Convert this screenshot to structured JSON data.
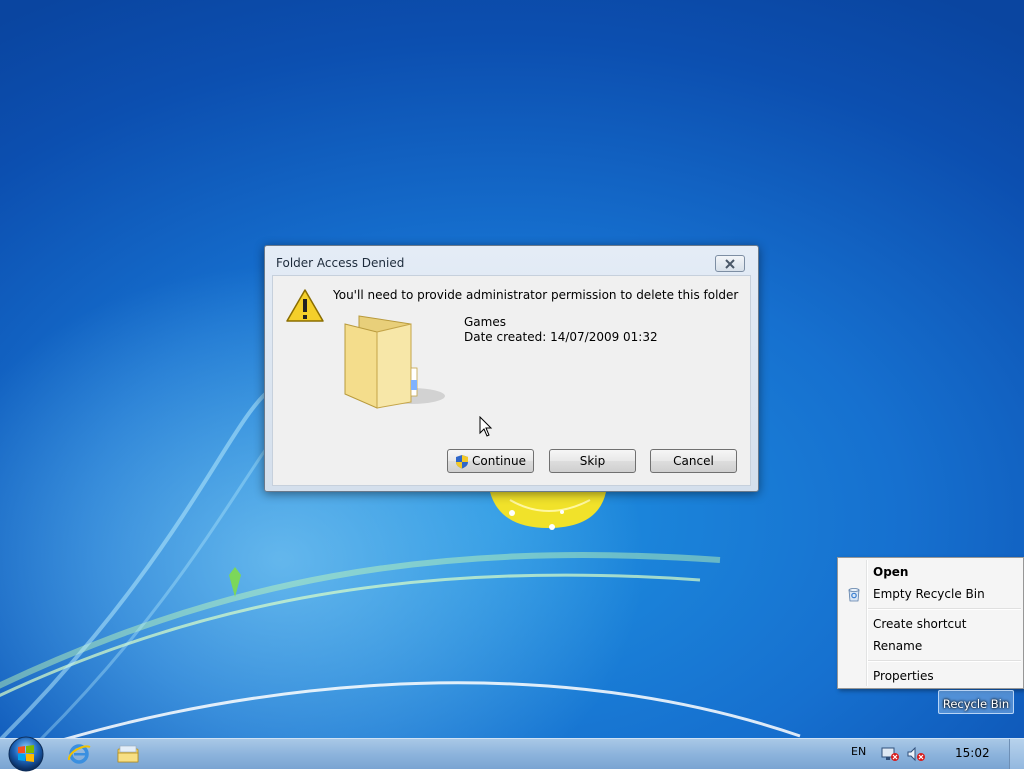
{
  "dialog": {
    "title": "Folder Access Denied",
    "message": "You'll need to provide administrator permission to delete this folder",
    "item_name": "Games",
    "item_date": "Date created: 14/07/2009 01:32",
    "buttons": {
      "continue": "Continue",
      "skip": "Skip",
      "cancel": "Cancel"
    }
  },
  "context_menu": {
    "items": [
      {
        "label": "Open",
        "bold": true
      },
      {
        "label": "Empty Recycle Bin",
        "icon": "recycle-bin-icon"
      },
      {
        "label": "Create shortcut"
      },
      {
        "label": "Rename"
      },
      {
        "label": "Properties"
      }
    ]
  },
  "desktop": {
    "icons": [
      {
        "label": "Recycle Bin",
        "icon": "recycle-bin-icon",
        "selected": true
      }
    ]
  },
  "taskbar": {
    "pinned": [
      "internet-explorer-icon",
      "windows-explorer-icon"
    ],
    "language": "EN",
    "clock": "15:02"
  },
  "colors": {
    "desktop_blue": "#1670cf",
    "taskbar": "#8db4dc",
    "dialog_frame": "#d4dfec"
  }
}
